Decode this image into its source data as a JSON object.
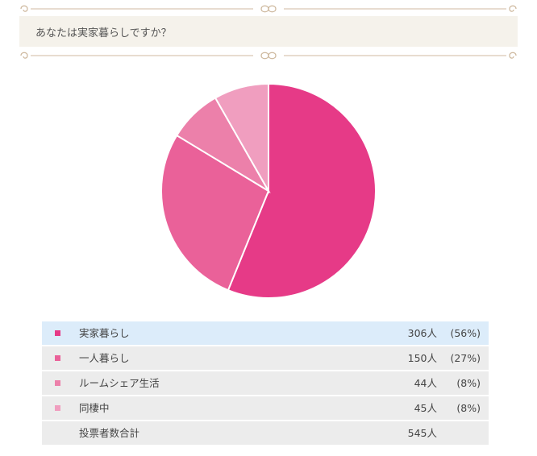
{
  "question": {
    "text": "あなたは実家暮らしですか？"
  },
  "decoration": {
    "line_color": "#d9c8b4",
    "ornament_icon": "flourish-icon"
  },
  "chart_data": {
    "type": "pie",
    "categories": [
      "実家暮らし",
      "一人暮らし",
      "ルームシェア生活",
      "同棲中"
    ],
    "values": [
      306,
      150,
      44,
      45
    ],
    "percent_labels": [
      "(56%)",
      "(27%)",
      "(8%)",
      "(8%)"
    ],
    "count_labels": [
      "306人",
      "150人",
      "44人",
      "45人"
    ],
    "colors": [
      "#e63a87",
      "#ea6199",
      "#ec80aa",
      "#f09ebf"
    ],
    "start_angle_deg": 0,
    "direction": "clockwise",
    "slice_border_color": "#ffffff",
    "legend": "below"
  },
  "results": {
    "rows": [
      {
        "label": "実家暮らし",
        "count": "306人",
        "pct": "(56%)",
        "color": "#e63a87"
      },
      {
        "label": "一人暮らし",
        "count": "150人",
        "pct": "(27%)",
        "color": "#ea6199"
      },
      {
        "label": "ルームシェア生活",
        "count": "44人",
        "pct": "(8%)",
        "color": "#ec80aa"
      },
      {
        "label": "同棲中",
        "count": "45人",
        "pct": "(8%)",
        "color": "#f09ebf"
      }
    ],
    "total_label": "投票者数合計",
    "total_count": "545人"
  }
}
